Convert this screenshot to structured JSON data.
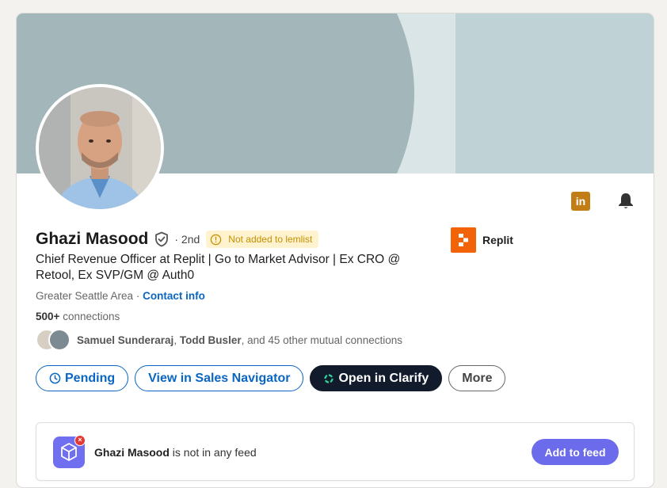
{
  "profile": {
    "name": "Ghazi Masood",
    "degree": "· 2nd",
    "lemlist_status": "Not added to lemlist",
    "headline": "Chief Revenue Officer at Replit | Go to Market Advisor | Ex CRO @ Retool, Ex SVP/GM @ Auth0",
    "location": "Greater Seattle Area",
    "separator": "·",
    "contact_info_label": "Contact info",
    "connections_count": "500+",
    "connections_label": "connections",
    "mutual": {
      "name1": "Samuel Sunderaraj",
      "name2": "Todd Busler",
      "rest": ", and 45 other mutual connections"
    }
  },
  "company": {
    "name": "Replit",
    "logo_color": "#f26207"
  },
  "actions": {
    "pending_label": "Pending",
    "sales_nav_label": "View in Sales Navigator",
    "clarify_label": "Open in Clarify",
    "more_label": "More"
  },
  "feed": {
    "name": "Ghazi Masood",
    "message": "is not in any feed",
    "add_button_label": "Add to feed"
  },
  "icons": {
    "linkedin": "linkedin-icon",
    "bell": "bell-icon",
    "verified": "shield-check-icon",
    "warning": "info-circle-icon",
    "clock": "clock-icon",
    "clarify": "clarify-logo-icon",
    "feed": "cube-icon",
    "feed_error": "close-icon"
  },
  "colors": {
    "accent_blue": "#0a66c2",
    "dark_button": "#111b2b",
    "feed_purple": "#6b6bec",
    "lemlist_bg": "#fff2cf",
    "linkedin_gold": "#c37d16"
  }
}
